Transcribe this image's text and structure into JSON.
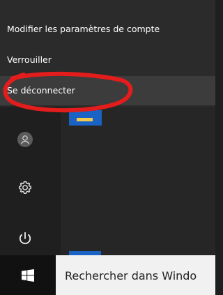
{
  "menu": {
    "items": [
      {
        "label": "Modifier les paramètres de compte"
      },
      {
        "label": "Verrouiller"
      },
      {
        "label": "Se déconnecter"
      }
    ]
  },
  "taskbar": {
    "search_text": "Rechercher dans Windo"
  },
  "icons": {
    "avatar": "avatar-icon",
    "settings": "gear-icon",
    "power": "power-icon",
    "start": "windows-logo-icon"
  },
  "colors": {
    "menu_bg": "#2b2b2b",
    "highlight_bg": "#3c3c3c",
    "annotation_red": "#e31c1c",
    "search_bg": "#f1f1f1",
    "tile_blue": "#1a62c4"
  }
}
